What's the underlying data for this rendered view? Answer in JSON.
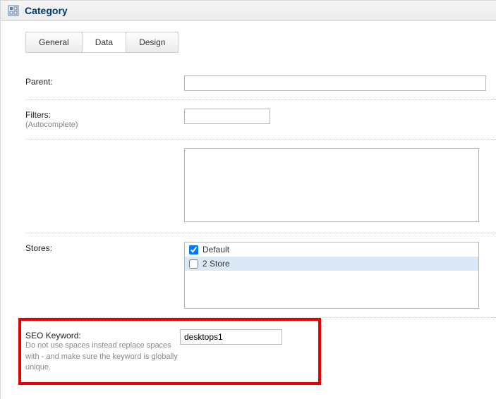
{
  "header": {
    "title": "Category"
  },
  "tabs": {
    "general": "General",
    "data": "Data",
    "design": "Design"
  },
  "form": {
    "parent": {
      "label": "Parent:",
      "value": ""
    },
    "filters": {
      "label": "Filters:",
      "hint": "(Autocomplete)",
      "value": ""
    },
    "textarea": {
      "value": ""
    },
    "stores": {
      "label": "Stores:",
      "options": [
        {
          "label": "Default",
          "checked": true,
          "selected": false
        },
        {
          "label": "2 Store",
          "checked": false,
          "selected": true
        }
      ]
    },
    "seo": {
      "label": "SEO Keyword:",
      "hint": "Do not use spaces instead replace spaces with - and make sure the keyword is globally unique.",
      "value": "desktops1"
    }
  }
}
